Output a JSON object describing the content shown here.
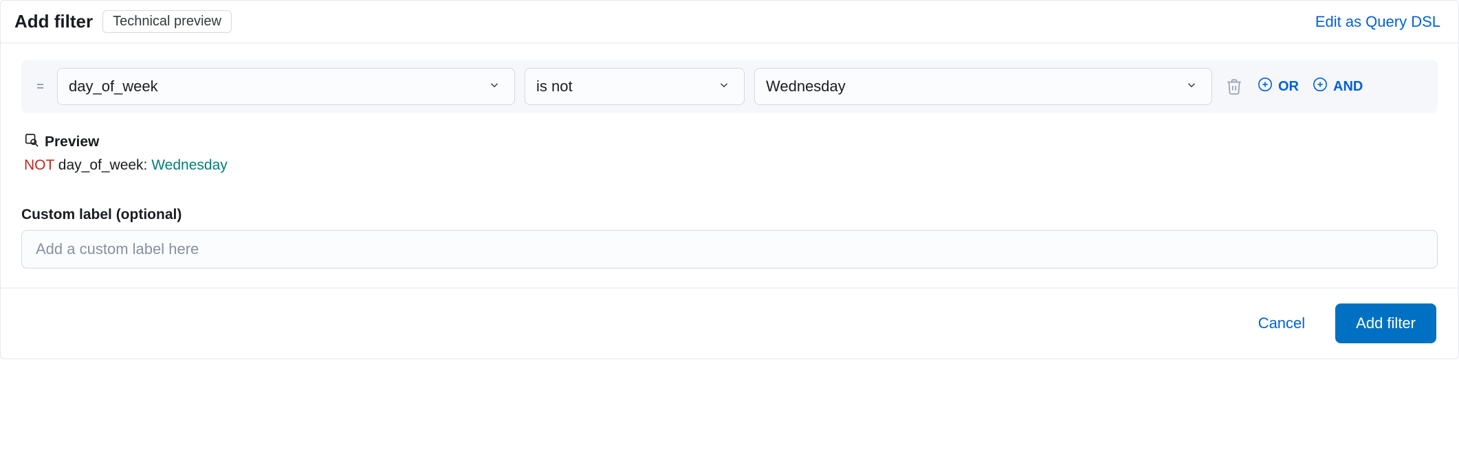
{
  "header": {
    "title": "Add filter",
    "badge": "Technical preview",
    "edit_link": "Edit as Query DSL"
  },
  "filter": {
    "field": "day_of_week",
    "operator": "is not",
    "value": "Wednesday",
    "or_label": "OR",
    "and_label": "AND"
  },
  "preview": {
    "heading": "Preview",
    "not_operator": "NOT",
    "field": "day_of_week:",
    "value": "Wednesday"
  },
  "custom_label": {
    "title": "Custom label (optional)",
    "placeholder": "Add a custom label here"
  },
  "footer": {
    "cancel": "Cancel",
    "submit": "Add filter"
  }
}
